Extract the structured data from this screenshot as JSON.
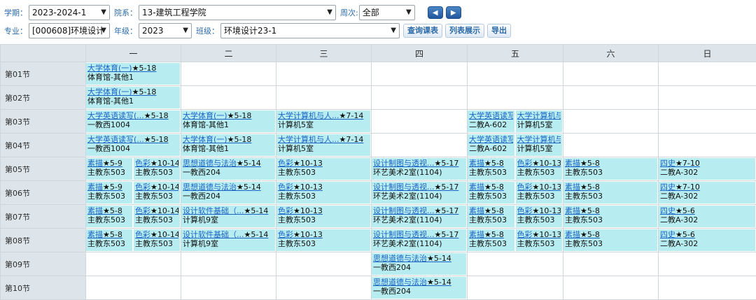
{
  "filters": {
    "term_label": "学期：",
    "term_value": "2023-2024-1",
    "dept_label": "院系：",
    "dept_value": "13-建筑工程学院",
    "week_label": "周次:",
    "week_value": "全部",
    "major_label": "专业：",
    "major_value": "[000608]环境设计",
    "grade_label": "年级：",
    "grade_value": "2023",
    "class_label": "班级：",
    "class_value": "环境设计23-1",
    "prev_label": "◀",
    "next_label": "▶",
    "query_button": "查询课表",
    "list_button": "列表展示",
    "export_button": "导出"
  },
  "days": [
    "一",
    "二",
    "三",
    "四",
    "五",
    "六",
    "日"
  ],
  "periods": [
    "第01节",
    "第02节",
    "第03节",
    "第04节",
    "第05节",
    "第06节",
    "第07节",
    "第08节",
    "第09节",
    "第10节"
  ],
  "schedule": [
    [
      [
        {
          "title": "大学体育(一)",
          "weeks": "★5-18",
          "room": "体育馆-其他1"
        }
      ],
      [],
      [],
      [],
      [],
      [],
      []
    ],
    [
      [
        {
          "title": "大学体育(一)",
          "weeks": "★5-18",
          "room": "体育馆-其他1"
        }
      ],
      [],
      [],
      [],
      [],
      [],
      []
    ],
    [
      [
        {
          "title": "大学英语读写(...",
          "weeks": "★5-18",
          "room": "一教西1004"
        }
      ],
      [
        {
          "title": "大学体育(一)",
          "weeks": "★5-18",
          "room": "体育馆-其他1"
        }
      ],
      [
        {
          "title": "大学计算机与人...",
          "weeks": "★7-14",
          "room": "计算机5室"
        }
      ],
      [],
      [
        {
          "title": "大学英语读写",
          "weeks": "",
          "room": "二教A-602"
        },
        {
          "title": "大学计算机与",
          "weeks": "",
          "room": "计算机5室"
        }
      ],
      [],
      []
    ],
    [
      [
        {
          "title": "大学英语读写(...",
          "weeks": "★5-18",
          "room": "一教西1004"
        }
      ],
      [
        {
          "title": "大学体育(一)",
          "weeks": "★5-18",
          "room": "体育馆-其他1"
        }
      ],
      [
        {
          "title": "大学计算机与人...",
          "weeks": "★7-14",
          "room": "计算机5室"
        }
      ],
      [],
      [
        {
          "title": "大学英语读写",
          "weeks": "",
          "room": "二教A-602"
        },
        {
          "title": "大学计算机与",
          "weeks": "",
          "room": "计算机5室"
        }
      ],
      [],
      []
    ],
    [
      [
        {
          "title": "素描",
          "weeks": "★5-9",
          "room": "主教东503"
        },
        {
          "title": "色彩",
          "weeks": "★10-14",
          "room": "主教东503"
        }
      ],
      [
        {
          "title": "思想道德与法治",
          "weeks": "★5-14",
          "room": "一教西204"
        }
      ],
      [
        {
          "title": "色彩",
          "weeks": "★10-13",
          "room": "主教东503"
        }
      ],
      [
        {
          "title": "设计制图与透视...",
          "weeks": "★5-17",
          "room": "环艺美术2室(1104)"
        }
      ],
      [
        {
          "title": "素描",
          "weeks": "★5-8",
          "room": "主教东503"
        },
        {
          "title": "色彩",
          "weeks": "★10-13",
          "room": "主教东503"
        }
      ],
      [
        {
          "title": "素描",
          "weeks": "★5-8",
          "room": "主教东503"
        }
      ],
      [
        {
          "title": "四史",
          "weeks": "★7-10",
          "room": "二教A-302"
        }
      ]
    ],
    [
      [
        {
          "title": "素描",
          "weeks": "★5-9",
          "room": "主教东503"
        },
        {
          "title": "色彩",
          "weeks": "★10-14",
          "room": "主教东503"
        }
      ],
      [
        {
          "title": "思想道德与法治",
          "weeks": "★5-14",
          "room": "一教西204"
        }
      ],
      [
        {
          "title": "色彩",
          "weeks": "★10-13",
          "room": "主教东503"
        }
      ],
      [
        {
          "title": "设计制图与透视...",
          "weeks": "★5-17",
          "room": "环艺美术2室(1104)"
        }
      ],
      [
        {
          "title": "素描",
          "weeks": "★5-8",
          "room": "主教东503"
        },
        {
          "title": "色彩",
          "weeks": "★10-13",
          "room": "主教东503"
        }
      ],
      [
        {
          "title": "素描",
          "weeks": "★5-8",
          "room": "主教东503"
        }
      ],
      [
        {
          "title": "四史",
          "weeks": "★7-10",
          "room": "二教A-302"
        }
      ]
    ],
    [
      [
        {
          "title": "素描",
          "weeks": "★5-8",
          "room": "主教东503"
        },
        {
          "title": "色彩",
          "weeks": "★10-14",
          "room": "主教东503"
        }
      ],
      [
        {
          "title": "设计软件基础（...",
          "weeks": "★5-14",
          "room": "计算机9室"
        }
      ],
      [
        {
          "title": "色彩",
          "weeks": "★10-13",
          "room": "主教东503"
        }
      ],
      [
        {
          "title": "设计制图与透视...",
          "weeks": "★5-17",
          "room": "环艺美术2室(1104)"
        }
      ],
      [
        {
          "title": "素描",
          "weeks": "★5-8",
          "room": "主教东503"
        },
        {
          "title": "色彩",
          "weeks": "★10-13",
          "room": "主教东503"
        }
      ],
      [
        {
          "title": "素描",
          "weeks": "★5-8",
          "room": "主教东503"
        }
      ],
      [
        {
          "title": "四史",
          "weeks": "★5-6",
          "room": "二教A-302"
        }
      ]
    ],
    [
      [
        {
          "title": "素描",
          "weeks": "★5-8",
          "room": "主教东503"
        },
        {
          "title": "色彩",
          "weeks": "★10-14",
          "room": "主教东503"
        }
      ],
      [
        {
          "title": "设计软件基础（...",
          "weeks": "★5-14",
          "room": "计算机9室"
        }
      ],
      [
        {
          "title": "色彩",
          "weeks": "★10-13",
          "room": "主教东503"
        }
      ],
      [
        {
          "title": "设计制图与透视...",
          "weeks": "★5-17",
          "room": "环艺美术2室(1104)"
        }
      ],
      [
        {
          "title": "素描",
          "weeks": "★5-8",
          "room": "主教东503"
        },
        {
          "title": "色彩",
          "weeks": "★10-13",
          "room": "主教东503"
        }
      ],
      [
        {
          "title": "素描",
          "weeks": "★5-8",
          "room": "主教东503"
        }
      ],
      [
        {
          "title": "四史",
          "weeks": "★5-6",
          "room": "二教A-302"
        }
      ]
    ],
    [
      [],
      [],
      [],
      [
        {
          "title": "思想道德与法治",
          "weeks": "★5-14",
          "room": "一教西204"
        }
      ],
      [],
      [],
      []
    ],
    [
      [],
      [],
      [],
      [
        {
          "title": "思想道德与法治",
          "weeks": "★5-14",
          "room": "一教西204"
        }
      ],
      [],
      [],
      []
    ]
  ],
  "colors": {
    "course_bg": "#b7edf0",
    "course_link": "#1b62c6",
    "header_bg": "#dde5ea",
    "label_blue": "#2b6aa8"
  }
}
